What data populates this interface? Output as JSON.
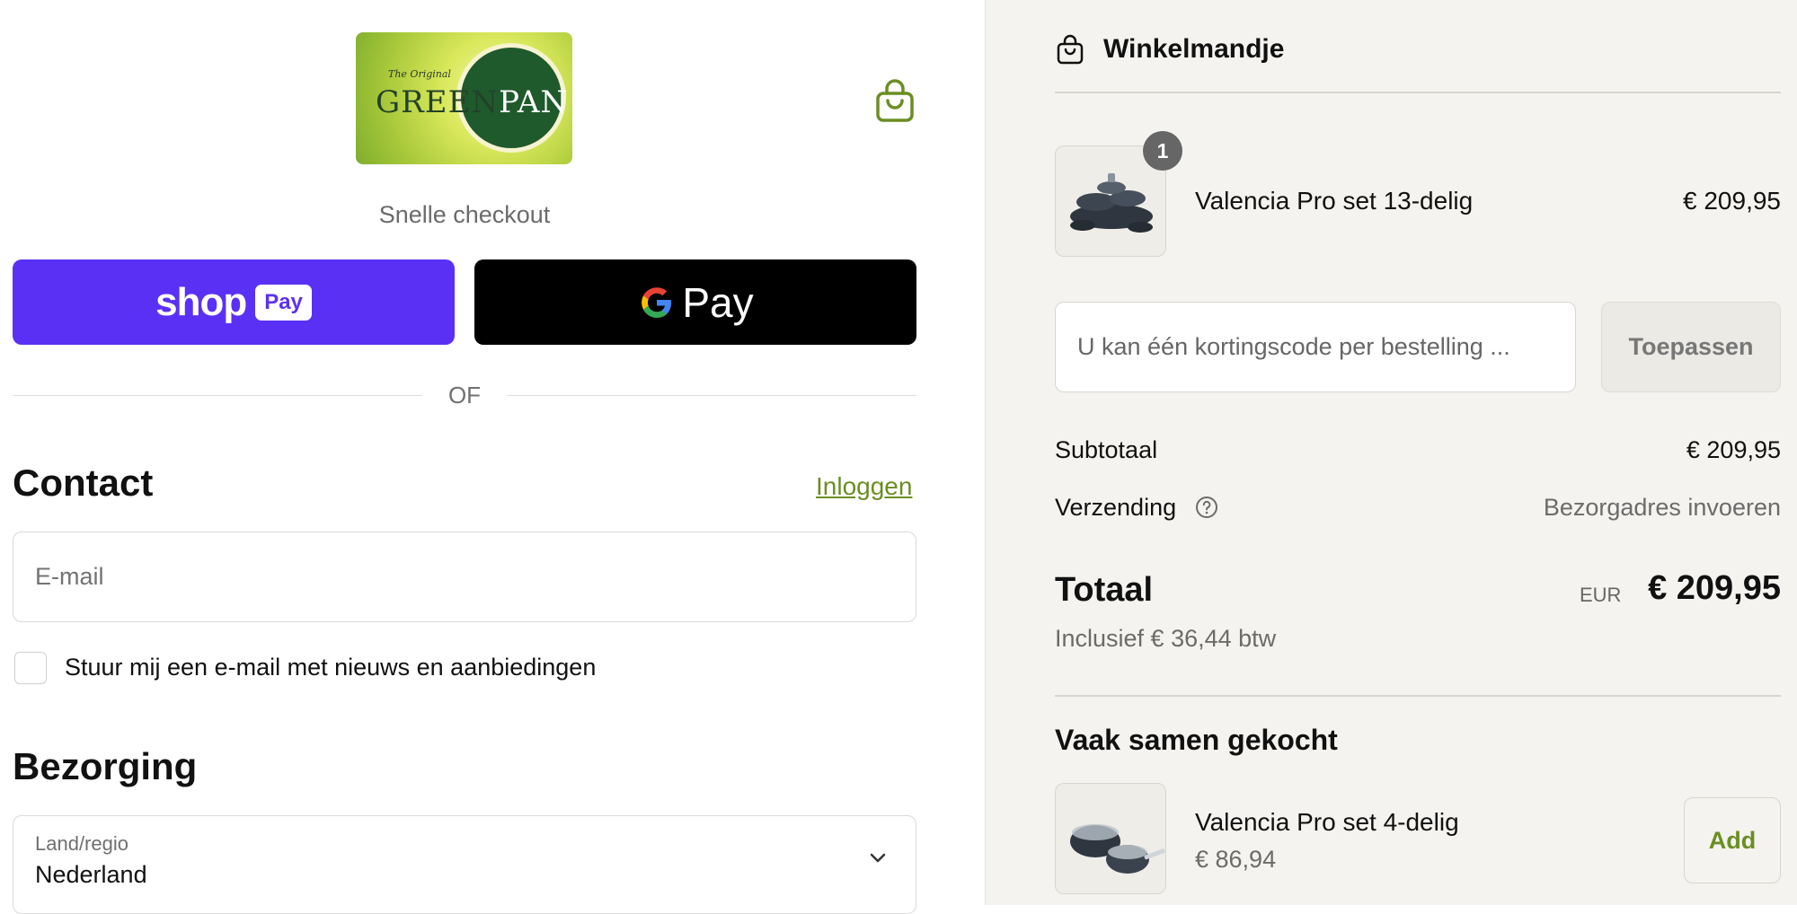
{
  "brand": {
    "logo_small": "The Original",
    "logo_green": "GREEN",
    "logo_pan": "PAN"
  },
  "checkout": {
    "express_title": "Snelle checkout",
    "shop_pay": {
      "word": "shop",
      "badge": "Pay"
    },
    "gpay_label": "Pay",
    "or_text": "OF"
  },
  "contact": {
    "heading": "Contact",
    "login_link": "Inloggen",
    "email_placeholder": "E-mail",
    "newsletter_label": "Stuur mij een e-mail met nieuws en aanbiedingen"
  },
  "delivery": {
    "heading": "Bezorging",
    "country_label": "Land/regio",
    "country_value": "Nederland"
  },
  "cart": {
    "title": "Winkelmandje",
    "items": [
      {
        "name": "Valencia Pro set 13-delig",
        "price": "€ 209,95",
        "quantity": "1"
      }
    ],
    "discount_placeholder": "U kan één kortingscode per bestelling ...",
    "apply_label": "Toepassen",
    "subtotal_label": "Subtotaal",
    "subtotal_value": "€ 209,95",
    "shipping_label": "Verzending",
    "shipping_value": "Bezorgadres invoeren",
    "total_label": "Totaal",
    "currency": "EUR",
    "total_value": "€ 209,95",
    "tax_note": "Inclusief € 36,44 btw"
  },
  "recommendations": {
    "heading": "Vaak samen gekocht",
    "items": [
      {
        "name": "Valencia Pro set 4-delig",
        "price": "€ 86,94",
        "button": "Add"
      }
    ]
  },
  "colors": {
    "shop_pay_purple": "#5a31f4",
    "gpay_black": "#000000",
    "accent_green": "#6b8e23",
    "summary_bg": "#f4f3ef"
  },
  "icons": [
    "shopping-bag-icon",
    "google-g-icon",
    "help-circle-icon",
    "chevron-down-icon"
  ]
}
